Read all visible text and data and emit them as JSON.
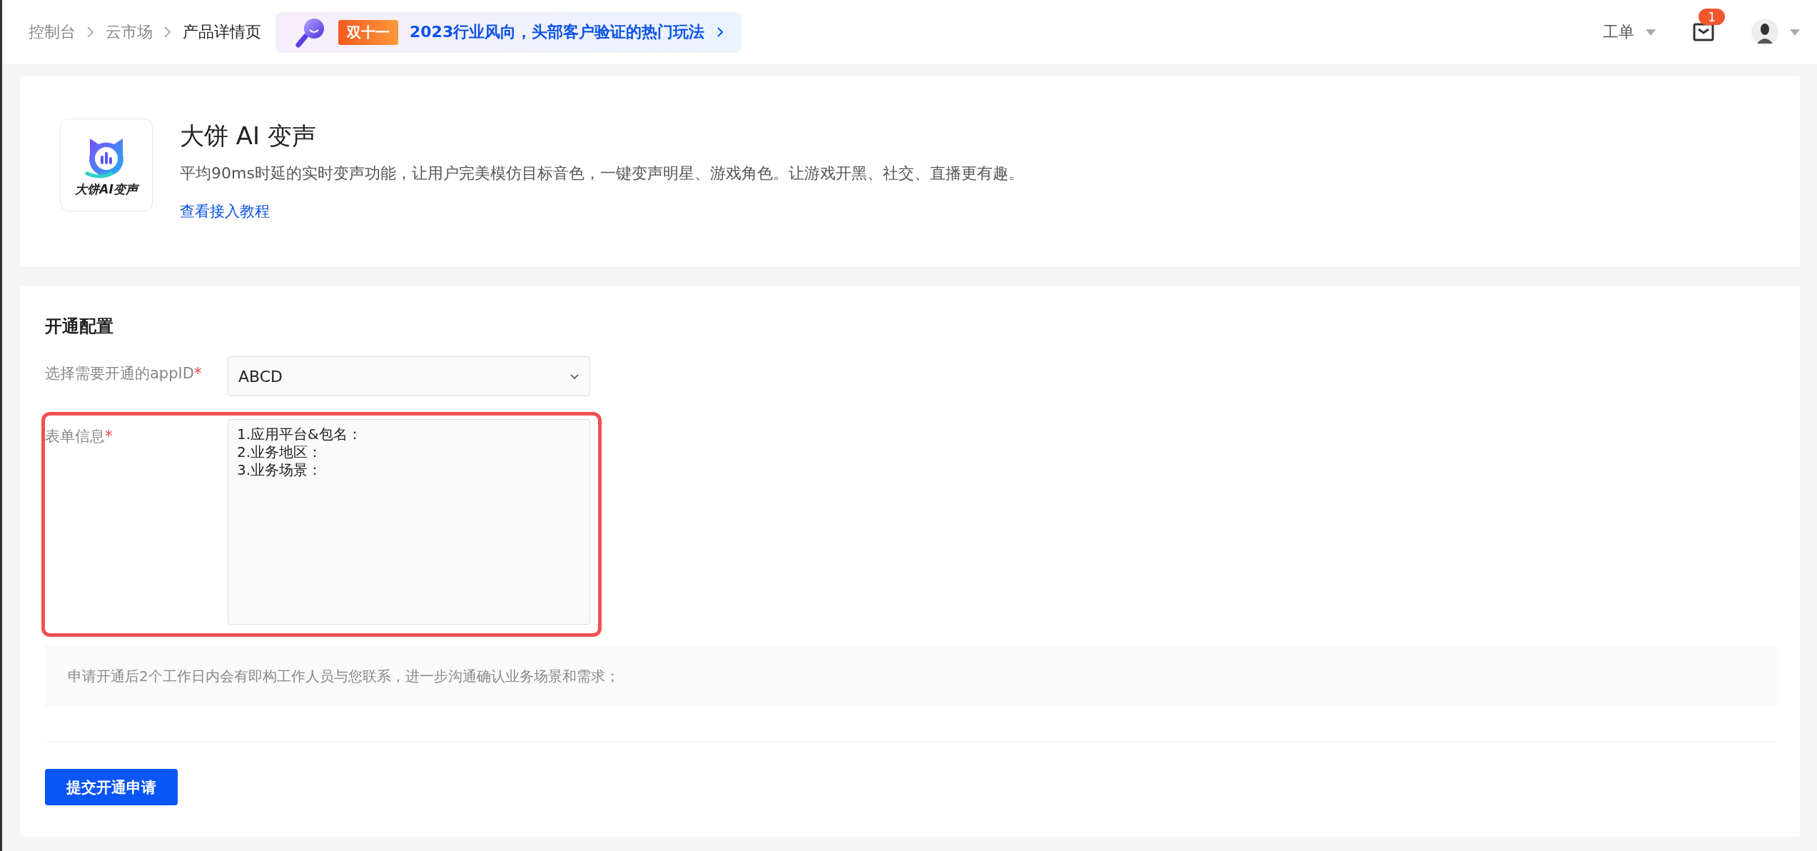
{
  "breadcrumbs": [
    {
      "label": "控制台",
      "selected": false
    },
    {
      "label": "云市场",
      "selected": false
    },
    {
      "label": "产品详情页",
      "selected": true
    }
  ],
  "promo": {
    "tag": "双十一",
    "text": "2023行业风向，头部客户验证的热门玩法"
  },
  "header_right": {
    "ticket_menu": "工单",
    "mail_badge": "1"
  },
  "product": {
    "logo_text": "大饼AI变声",
    "name": "大饼 AI 变声",
    "description": "平均90ms时延的实时变声功能，让用户完美模仿目标音色，一键变声明星、游戏角色。让游戏开黑、社交、直播更有趣。",
    "tutorial_link": "查看接入教程"
  },
  "config": {
    "title": "开通配置",
    "fields": [
      {
        "kind": "select",
        "label": "选择需要开通的appID",
        "required_mark": "*",
        "value": "ABCD"
      },
      {
        "kind": "textarea",
        "label": "表单信息",
        "required_mark": "*",
        "value": "1.应用平台&包名：\n2.业务地区：\n3.业务场景：",
        "highlighted": true
      }
    ],
    "notice": "申请开通后2个工作日内会有即构工作人员与您联系，进一步沟通确认业务场景和需求；",
    "submit": "提交开通申请"
  }
}
